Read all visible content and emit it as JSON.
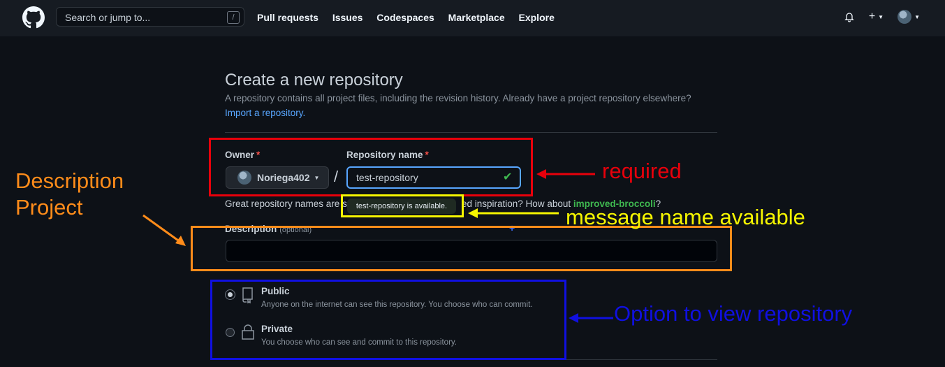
{
  "header": {
    "search_placeholder": "Search or jump to...",
    "search_shortcut": "/",
    "nav": [
      "Pull requests",
      "Issues",
      "Codespaces",
      "Marketplace",
      "Explore"
    ],
    "icons": [
      "github-logo",
      "bell-icon",
      "plus-icon",
      "avatar"
    ]
  },
  "page": {
    "title": "Create a new repository",
    "subtitle": "A repository contains all project files, including the revision history. Already have a project repository elsewhere?",
    "import_link": "Import a repository."
  },
  "form": {
    "owner_label": "Owner",
    "owner_value": "Noriega402",
    "repo_label": "Repository name",
    "repo_value": "test-repository",
    "separator": "/",
    "required_mark": "*",
    "hint_prefix": "Great repository names are s",
    "hint_suffix": "ed inspiration? How about",
    "suggestion": "improved-broccoli",
    "hint_end": "?",
    "availability_tooltip": "test-repository is available.",
    "description_label": "Description",
    "description_optional": "(optional)",
    "description_value": ""
  },
  "visibility": {
    "options": [
      {
        "title": "Public",
        "desc": "Anyone on the internet can see this repository. You choose who can commit.",
        "selected": true,
        "icon": "repo-icon"
      },
      {
        "title": "Private",
        "desc": "You choose who can see and commit to this repository.",
        "selected": false,
        "icon": "lock-icon"
      }
    ]
  },
  "annotations": {
    "required": "required",
    "message_available": "message name available",
    "description_project_1": "Description",
    "description_project_2": "Project",
    "option_view": "Option to view repository",
    "colors": {
      "red": "#e8000b",
      "yellow": "#f5f500",
      "orange": "#ff8c1a",
      "blue": "#1010e0"
    }
  }
}
